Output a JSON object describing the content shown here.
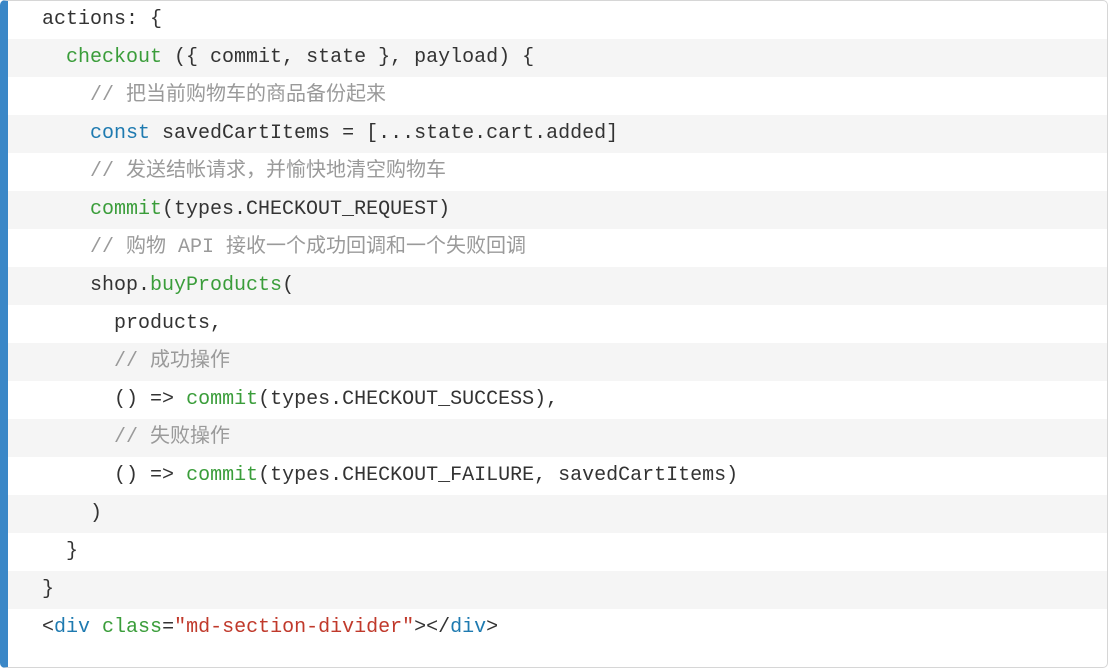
{
  "code": {
    "lines": [
      {
        "indent": 0,
        "tokens": [
          [
            "plain",
            "actions"
          ],
          [
            "operator",
            ":"
          ],
          [
            "plain",
            " {"
          ]
        ]
      },
      {
        "indent": 1,
        "tokens": [
          [
            "ident-call",
            "checkout"
          ],
          [
            "plain",
            " ("
          ],
          [
            "plain",
            "{ commit, state }"
          ],
          [
            "plain",
            ", payload"
          ],
          [
            "plain",
            ")"
          ],
          [
            "plain",
            " {"
          ]
        ]
      },
      {
        "indent": 2,
        "tokens": [
          [
            "comment",
            "// 把当前购物车的商品备份起来"
          ]
        ]
      },
      {
        "indent": 2,
        "tokens": [
          [
            "keyword",
            "const"
          ],
          [
            "plain",
            " savedCartItems "
          ],
          [
            "operator",
            "="
          ],
          [
            "plain",
            " [...state.cart.added]"
          ]
        ]
      },
      {
        "indent": 2,
        "tokens": [
          [
            "comment",
            "// 发送结帐请求，并愉快地清空购物车"
          ]
        ]
      },
      {
        "indent": 2,
        "tokens": [
          [
            "ident-call",
            "commit"
          ],
          [
            "plain",
            "(types.CHECKOUT_REQUEST)"
          ]
        ]
      },
      {
        "indent": 2,
        "tokens": [
          [
            "comment",
            "// 购物 API 接收一个成功回调和一个失败回调"
          ]
        ]
      },
      {
        "indent": 2,
        "tokens": [
          [
            "plain",
            "shop."
          ],
          [
            "ident-call",
            "buyProducts"
          ],
          [
            "plain",
            "("
          ]
        ]
      },
      {
        "indent": 3,
        "tokens": [
          [
            "plain",
            "products,"
          ]
        ]
      },
      {
        "indent": 3,
        "tokens": [
          [
            "comment",
            "// 成功操作"
          ]
        ]
      },
      {
        "indent": 3,
        "tokens": [
          [
            "plain",
            "() "
          ],
          [
            "operator",
            "=>"
          ],
          [
            "plain",
            " "
          ],
          [
            "ident-call",
            "commit"
          ],
          [
            "plain",
            "(types.CHECKOUT_SUCCESS),"
          ]
        ]
      },
      {
        "indent": 3,
        "tokens": [
          [
            "comment",
            "// 失败操作"
          ]
        ]
      },
      {
        "indent": 3,
        "tokens": [
          [
            "plain",
            "() "
          ],
          [
            "operator",
            "=>"
          ],
          [
            "plain",
            " "
          ],
          [
            "ident-call",
            "commit"
          ],
          [
            "plain",
            "(types.CHECKOUT_FAILURE, savedCartItems)"
          ]
        ]
      },
      {
        "indent": 2,
        "tokens": [
          [
            "plain",
            ")"
          ]
        ]
      },
      {
        "indent": 1,
        "tokens": [
          [
            "plain",
            "}"
          ]
        ]
      },
      {
        "indent": 0,
        "tokens": [
          [
            "plain",
            "}"
          ]
        ]
      },
      {
        "indent": 0,
        "html_line": true,
        "tokens": [
          [
            "punct",
            "<"
          ],
          [
            "tag-color",
            "div"
          ],
          [
            "plain",
            " "
          ],
          [
            "attr-name",
            "class"
          ],
          [
            "operator",
            "="
          ],
          [
            "attr-val",
            "\"md-section-divider\""
          ],
          [
            "punct",
            "></"
          ],
          [
            "tag-color",
            "div"
          ],
          [
            "punct",
            ">"
          ]
        ]
      }
    ],
    "indent_unit": "  "
  }
}
